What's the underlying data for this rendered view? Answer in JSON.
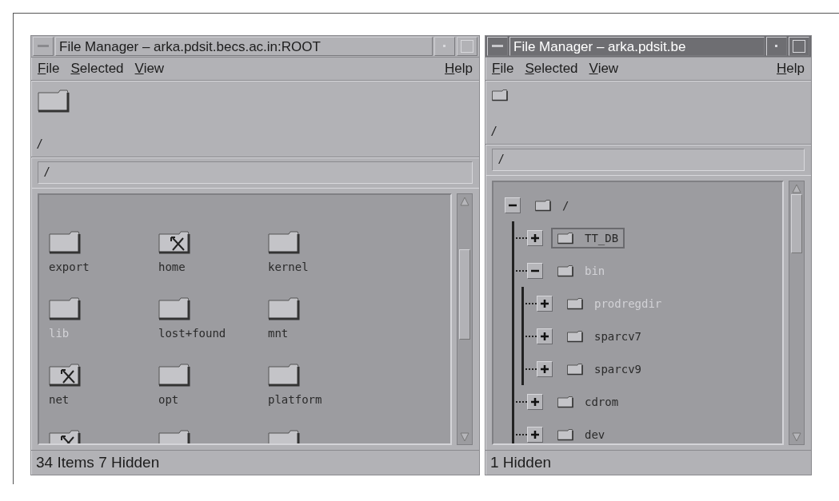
{
  "windows": [
    {
      "title": "File Manager – arka.pdsit.becs.ac.in:ROOT",
      "active": false,
      "menu": [
        {
          "label": "File"
        },
        {
          "label": "Selected"
        },
        {
          "label": "View"
        },
        {
          "label": "Help"
        }
      ],
      "current_path": "/",
      "path_field": "/",
      "status": "34 Items 7 Hidden",
      "items": [
        {
          "label": "export",
          "kind": "folder",
          "dimmed": false
        },
        {
          "label": "home",
          "kind": "linked-folder",
          "dimmed": false
        },
        {
          "label": "kernel",
          "kind": "folder",
          "dimmed": false
        },
        {
          "label": "lib",
          "kind": "folder",
          "dimmed": true
        },
        {
          "label": "lost+found",
          "kind": "folder",
          "dimmed": false
        },
        {
          "label": "mnt",
          "kind": "folder",
          "dimmed": false
        },
        {
          "label": "net",
          "kind": "linked-folder",
          "dimmed": false
        },
        {
          "label": "opt",
          "kind": "folder",
          "dimmed": false
        },
        {
          "label": "platform",
          "kind": "folder",
          "dimmed": false
        },
        {
          "kind": "linked-folder"
        },
        {
          "kind": "folder"
        },
        {
          "kind": "folder"
        }
      ]
    },
    {
      "title": "File Manager – arka.pdsit.be",
      "active": true,
      "menu": [
        {
          "label": "File"
        },
        {
          "label": "Selected"
        },
        {
          "label": "View"
        },
        {
          "label": "Help"
        }
      ],
      "current_path": "/",
      "path_field": "/",
      "status": "1 Hidden",
      "tree": [
        {
          "label": "/",
          "expanded": true,
          "selected": false,
          "dimmed": false,
          "children": [
            {
              "label": "TT_DB",
              "expanded": false,
              "selected": true,
              "dimmed": false
            },
            {
              "label": "bin",
              "expanded": true,
              "selected": false,
              "dimmed": true,
              "children": [
                {
                  "label": "prodregdir",
                  "expanded": false,
                  "selected": false,
                  "dimmed": true
                },
                {
                  "label": "sparcv7",
                  "expanded": false,
                  "selected": false,
                  "dimmed": false
                },
                {
                  "label": "sparcv9",
                  "expanded": false,
                  "selected": false,
                  "dimmed": false
                }
              ]
            },
            {
              "label": "cdrom",
              "expanded": false,
              "selected": false,
              "dimmed": false
            },
            {
              "label": "dev",
              "expanded": false,
              "selected": false,
              "dimmed": false
            }
          ]
        }
      ]
    }
  ]
}
